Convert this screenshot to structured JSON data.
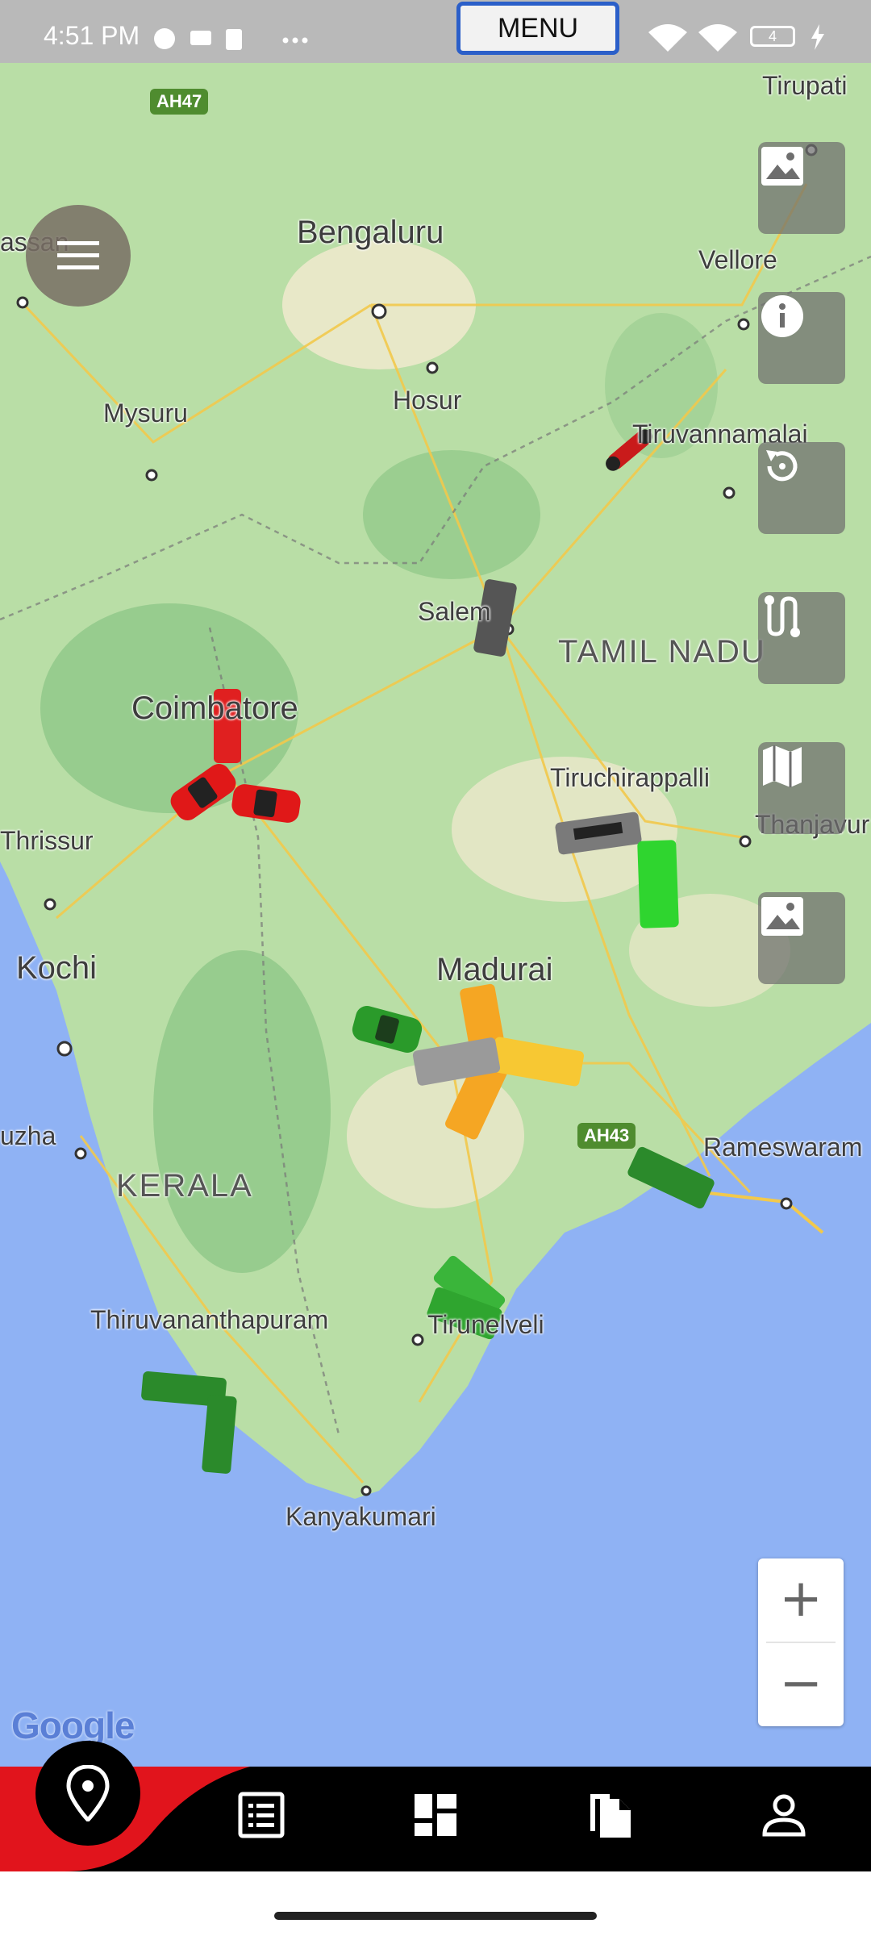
{
  "status_bar": {
    "time": "4:51 PM",
    "battery": "4",
    "menu_label": "MENU"
  },
  "map": {
    "cities": [
      {
        "id": "tirupati",
        "name": "Tirupati"
      },
      {
        "id": "bengaluru",
        "name": "Bengaluru"
      },
      {
        "id": "vellore",
        "name": "Vellore"
      },
      {
        "id": "hassan",
        "name": "assan"
      },
      {
        "id": "mysuru",
        "name": "Mysuru"
      },
      {
        "id": "hosur",
        "name": "Hosur"
      },
      {
        "id": "tiruvannamalai",
        "name": "Tiruvannamalai"
      },
      {
        "id": "salem",
        "name": "Salem"
      },
      {
        "id": "coimbatore",
        "name": "Coimbatore"
      },
      {
        "id": "tiruchirappalli",
        "name": "Tiruchirappalli"
      },
      {
        "id": "thanjavur",
        "name": "Thanjavur"
      },
      {
        "id": "thrissur",
        "name": "Thrissur"
      },
      {
        "id": "kochi",
        "name": "Kochi"
      },
      {
        "id": "madurai",
        "name": "Madurai"
      },
      {
        "id": "alappuzha",
        "name": "uzha"
      },
      {
        "id": "rameswaram",
        "name": "Rameswaram"
      },
      {
        "id": "thiruvananthapuram",
        "name": "Thiruvananthapuram"
      },
      {
        "id": "tirunelveli",
        "name": "Tirunelveli"
      },
      {
        "id": "kanyakumari",
        "name": "Kanyakumari"
      }
    ],
    "states": {
      "tamil_nadu": "TAMIL NADU",
      "kerala": "KERALA"
    },
    "highways": {
      "ah47": "AH47",
      "ah43": "AH43"
    },
    "attribution": "Google"
  },
  "controls": {
    "fab_icons": [
      "image-icon",
      "info-icon",
      "refresh-icon",
      "route-icon",
      "map-icon",
      "image-icon"
    ],
    "zoom_in": "+",
    "zoom_out": "−"
  },
  "bottom_nav": {
    "items": [
      "location-pin-icon",
      "list-icon",
      "dashboard-icon",
      "documents-icon",
      "profile-icon"
    ]
  },
  "colors": {
    "map_land": "#b9dea6",
    "sea": "#8fb2f4",
    "nav_bg": "#000000",
    "accent": "#e1141c"
  }
}
